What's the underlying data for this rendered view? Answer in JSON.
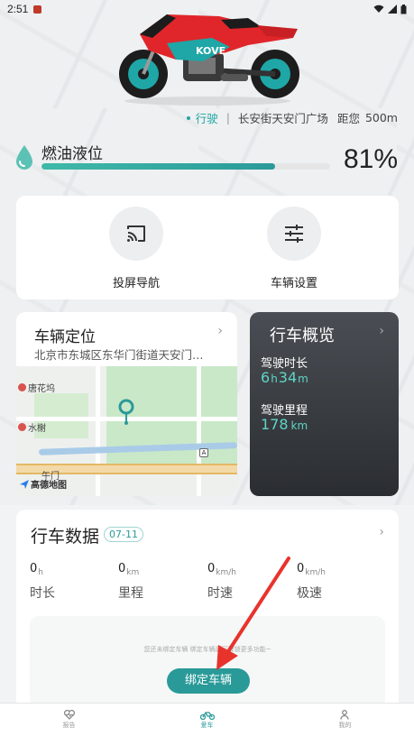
{
  "status_bar": {
    "time": "2:51",
    "icons": [
      "app-notification-icon",
      "wifi-icon",
      "signal-icon",
      "battery-icon"
    ]
  },
  "riding": {
    "mode": "行驶",
    "location": "长安街天安门广场",
    "distance_prefix": "距您",
    "distance": "500m"
  },
  "fuel": {
    "label": "燃油液位",
    "percent_text": "81%",
    "level": 0.81
  },
  "actions": {
    "cast_nav_label": "投屏导航",
    "vehicle_settings_label": "车辆设置"
  },
  "location_card": {
    "title": "车辆定位",
    "address": "北京市东城区东华门街道天安门…",
    "map": {
      "poi_1": "唐花坞",
      "poi_2": "水榭",
      "poi_3": "午门",
      "logo": "高德地图",
      "badge": "A"
    }
  },
  "overview": {
    "title": "行车概览",
    "duration_label": "驾驶时长",
    "duration_hours": "6",
    "duration_hours_unit": "h",
    "duration_minutes": "34",
    "duration_minutes_unit": "m",
    "mileage_label": "驾驶里程",
    "mileage_value": "178",
    "mileage_unit": "km"
  },
  "trip": {
    "title": "行车数据",
    "date": "07-11",
    "metrics": [
      {
        "value": "0",
        "unit": "h",
        "name": "时长"
      },
      {
        "value": "0",
        "unit": "km",
        "name": "里程"
      },
      {
        "value": "0",
        "unit": "km/h",
        "name": "时速"
      },
      {
        "value": "0",
        "unit": "km/h",
        "name": "极速"
      }
    ],
    "bind_hint": "您还未绑定车辆 绑定车辆后可解锁更多功能~",
    "bind_button": "绑定车辆"
  },
  "bottom_nav": {
    "items": [
      {
        "label": "报告",
        "icon": "heart-pulse-icon"
      },
      {
        "label": "爱车",
        "icon": "motorcycle-icon"
      },
      {
        "label": "我的",
        "icon": "user-icon"
      }
    ],
    "active_index": 1
  },
  "colors": {
    "accent": "#2a9a99",
    "moto_red": "#e0262b",
    "moto_teal": "#1fa6a6",
    "overview_bg": "#2a2d31"
  }
}
